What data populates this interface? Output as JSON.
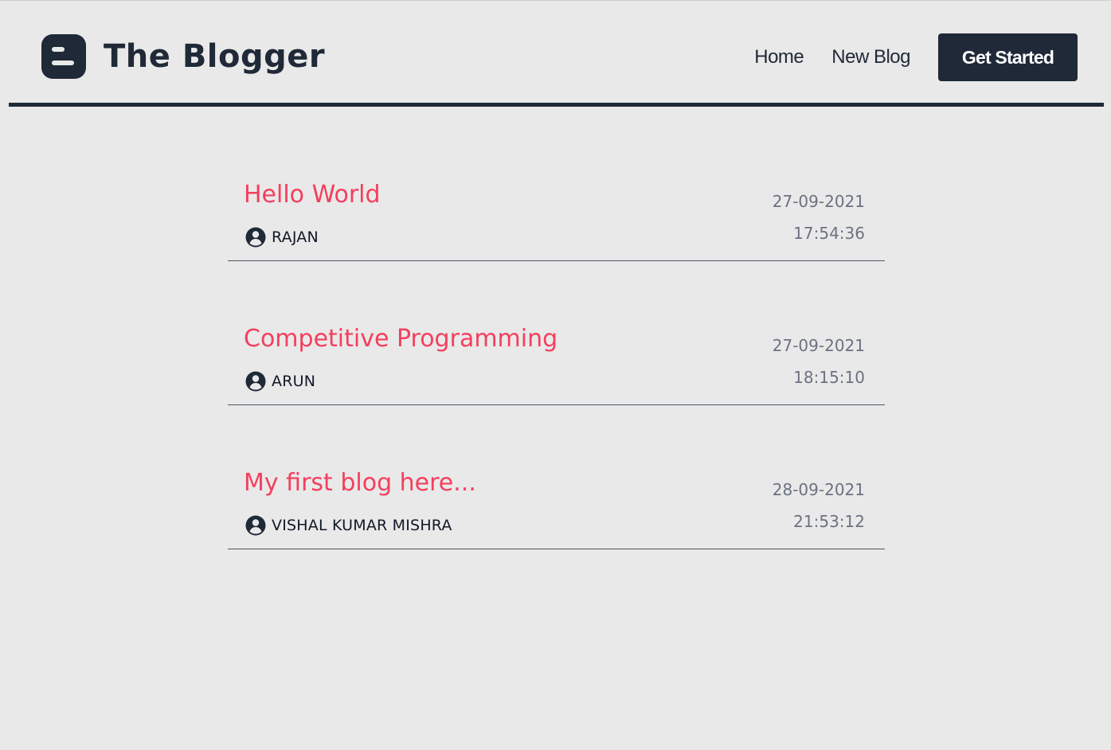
{
  "header": {
    "brand_title": "The Blogger",
    "logo_icon": "blogger-logo-icon",
    "nav": {
      "home_label": "Home",
      "new_blog_label": "New Blog",
      "get_started_label": "Get Started"
    }
  },
  "blogs": [
    {
      "title": "Hello World",
      "author": "RAJAN",
      "date": "27-09-2021",
      "time": "17:54:36"
    },
    {
      "title": "Competitive Programming",
      "author": "ARUN",
      "date": "27-09-2021",
      "time": "18:15:10"
    },
    {
      "title": "My first blog here...",
      "author": "VISHAL KUMAR MISHRA",
      "date": "28-09-2021",
      "time": "21:53:12"
    }
  ],
  "icons": {
    "author": "user-circle-icon"
  },
  "colors": {
    "background": "#e9e9e9",
    "primary_dark": "#1f2937",
    "title_accent": "#f43f5e",
    "meta_text": "#6b7280"
  }
}
